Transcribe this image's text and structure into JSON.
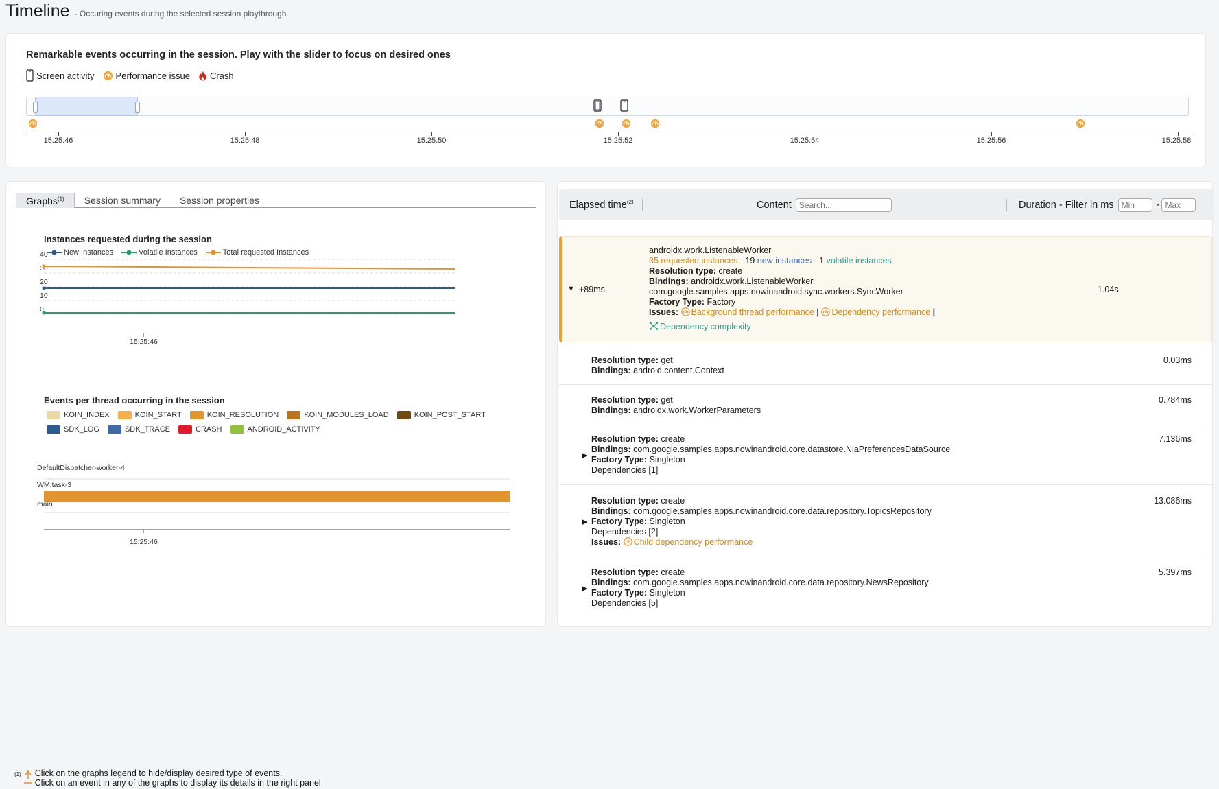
{
  "header": {
    "title": "Timeline",
    "subtitle": "- Occuring events during the selected session playthrough."
  },
  "timeline": {
    "heading": "Remarkable events occurring in the session. Play with the slider to focus on desired ones",
    "legend": {
      "screen_activity": "Screen activity",
      "performance_issue": "Performance issue",
      "crash": "Crash"
    },
    "ticks": [
      "15:25:46",
      "15:25:48",
      "15:25:50",
      "15:25:52",
      "15:25:54",
      "15:25:56",
      "15:25:58"
    ],
    "colors": {
      "performance": "#f2a33a",
      "crash": "#d7261e",
      "selection": "#dbe7fb"
    }
  },
  "left_panel": {
    "tabs": {
      "graphs": "Graphs",
      "graphs_note": "(1)",
      "summary": "Session summary",
      "properties": "Session properties"
    },
    "instances_chart": {
      "title": "Instances requested during the session",
      "legend": {
        "new": "New Instances",
        "volatile": "Volatile Instances",
        "total": "Total requested Instances"
      },
      "y_ticks": [
        "40",
        "30",
        "20",
        "10",
        "0"
      ],
      "x_tick": "15:25:46"
    },
    "threads_chart": {
      "title": "Events per thread occurring in the session",
      "legend_row1": [
        {
          "label": "KOIN_INDEX",
          "color": "#e9d9a6"
        },
        {
          "label": "KOIN_START",
          "color": "#f5b04a"
        },
        {
          "label": "KOIN_RESOLUTION",
          "color": "#e0952f"
        },
        {
          "label": "KOIN_MODULES_LOAD",
          "color": "#b8741f"
        },
        {
          "label": "KOIN_POST_START",
          "color": "#6e4a12"
        }
      ],
      "legend_row2": [
        {
          "label": "SDK_LOG",
          "color": "#2f5a8e"
        },
        {
          "label": "SDK_TRACE",
          "color": "#3e6aa6"
        },
        {
          "label": "CRASH",
          "color": "#e01a2a"
        },
        {
          "label": "ANDROID_ACTIVITY",
          "color": "#92c13c"
        }
      ],
      "threads": [
        "DefaultDispatcher-worker-4",
        "WM.task-3",
        "main"
      ],
      "x_tick": "15:25:46"
    },
    "footnote": {
      "marker": "(1)",
      "line1": "Click on the graphs legend to hide/display desired type of events.",
      "line2": "Click on an event in any of the graphs to display its details in the right panel"
    }
  },
  "chart_data": {
    "type": "line",
    "title": "Instances requested during the session",
    "x": [
      "15:25:46"
    ],
    "series": [
      {
        "name": "New Instances",
        "values": [
          19,
          19
        ]
      },
      {
        "name": "Volatile Instances",
        "values": [
          1,
          1
        ]
      },
      {
        "name": "Total requested Instances",
        "values": [
          35,
          33
        ]
      }
    ],
    "ylim": [
      0,
      40
    ]
  },
  "right_panel": {
    "header": {
      "elapsed": "Elapsed time",
      "elapsed_note": "(2)",
      "content": "Content",
      "search_placeholder": "Search...",
      "duration": "Duration - Filter in ms",
      "min_placeholder": "Min",
      "max_placeholder": "Max",
      "dash": "-"
    },
    "main_entry": {
      "elapsed": "+89ms",
      "title": "androidx.work.ListenableWorker",
      "requested_count": "35",
      "requested_label": "requested instances",
      "sep1": "- 19",
      "new_label": "new instances",
      "sep2": "- 1",
      "volatile_label": "volatile instances",
      "resolution_label": "Resolution type:",
      "resolution_value": "create",
      "bindings_label": "Bindings:",
      "bindings_line1": "androidx.work.ListenableWorker,",
      "bindings_line2": "com.google.samples.apps.nowinandroid.sync.workers.SyncWorker",
      "factory_label": "Factory Type:",
      "factory_value": "Factory",
      "issues_label": "Issues:",
      "issue1": "Background thread performance",
      "issue2": "Dependency performance",
      "issue3": "Dependency complexity",
      "duration": "1.04s"
    },
    "rows": [
      {
        "resolution": "get",
        "bindings": "android.content.Context",
        "duration": "0.03ms"
      },
      {
        "resolution": "get",
        "bindings": "androidx.work.WorkerParameters",
        "duration": "0.784ms"
      },
      {
        "resolution": "create",
        "bindings": "com.google.samples.apps.nowinandroid.core.datastore.NiaPreferencesDataSource",
        "factory": "Singleton",
        "deps": "Dependencies [1]",
        "duration": "7.136ms"
      },
      {
        "resolution": "create",
        "bindings": "com.google.samples.apps.nowinandroid.core.data.repository.TopicsRepository",
        "factory": "Singleton",
        "deps": "Dependencies [2]",
        "issue": "Child dependency performance",
        "duration": "13.086ms"
      },
      {
        "resolution": "create",
        "bindings": "com.google.samples.apps.nowinandroid.core.data.repository.NewsRepository",
        "factory": "Singleton",
        "deps": "Dependencies [5]",
        "duration": "5.397ms"
      }
    ],
    "labels": {
      "resolution": "Resolution type:",
      "bindings": "Bindings:",
      "factory": "Factory Type:",
      "issues": "Issues:"
    }
  }
}
